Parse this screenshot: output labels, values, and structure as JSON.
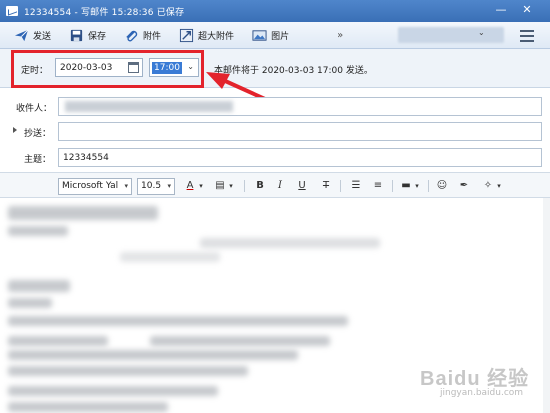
{
  "window": {
    "title": "12334554 - 写邮件   15:28:36 已保存"
  },
  "toolbar": {
    "send_label": "发送",
    "save_label": "保存",
    "attach_label": "附件",
    "large_attach_label": "超大附件",
    "image_label": "图片",
    "more_label": "»"
  },
  "schedule": {
    "label": "定时：",
    "date": "2020-03-03",
    "time": "17:00",
    "info": "本邮件将于 2020-03-03 17:00 发送。"
  },
  "fields": {
    "to_label": "收件人：",
    "cc_label": "抄送：",
    "subject_label": "主题：",
    "subject_value": "12334554"
  },
  "format": {
    "font": "Microsoft Yal",
    "size": "10.5"
  },
  "watermark": {
    "text": "Baidu 经验",
    "sub": "jingyan.baidu.com"
  },
  "colors": {
    "highlight": "#e3232c",
    "title_bar": "#3a6fb6",
    "selection": "#3a7bd5"
  }
}
